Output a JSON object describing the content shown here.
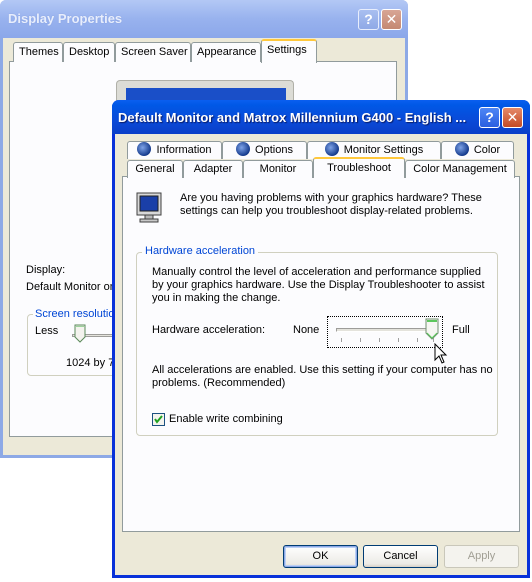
{
  "back_window": {
    "title": "Display Properties",
    "help_glyph": "?",
    "close_glyph": "✕",
    "tabs": [
      "Themes",
      "Desktop",
      "Screen Saver",
      "Appearance",
      "Settings"
    ],
    "active_tab": "Settings",
    "display_label": "Display:",
    "display_value": "Default Monitor on",
    "screen_resolution_label": "Screen resolutio",
    "less_label": "Less",
    "resolution_value": "1024 by 7"
  },
  "front_window": {
    "title": "Default Monitor and Matrox Millennium G400 - English ...",
    "help_glyph": "?",
    "close_glyph": "✕",
    "tabs_row1": [
      {
        "label": "Information",
        "icon": "matrox-icon"
      },
      {
        "label": "Options",
        "icon": "matrox-icon"
      },
      {
        "label": "Monitor Settings",
        "icon": "matrox-icon"
      },
      {
        "label": "Color",
        "icon": "matrox-icon"
      }
    ],
    "tabs_row2": [
      "General",
      "Adapter",
      "Monitor",
      "Troubleshoot",
      "Color Management"
    ],
    "active_tab": "Troubleshoot",
    "intro_text": "Are you having problems with your graphics hardware? These settings can help you troubleshoot display-related problems.",
    "hardware_group": {
      "title": "Hardware acceleration",
      "description": "Manually control the level of acceleration and performance supplied by your graphics hardware. Use the Display Troubleshooter to assist you in making the change.",
      "slider_label": "Hardware acceleration:",
      "slider_min_label": "None",
      "slider_max_label": "Full",
      "slider_level": 1.0,
      "status_text": "All accelerations are enabled. Use this setting if your computer has no problems. (Recommended)",
      "checkbox_label": "Enable write combining",
      "checkbox_checked": true
    },
    "buttons": {
      "ok": "OK",
      "cancel": "Cancel",
      "apply": "Apply"
    }
  },
  "colors": {
    "active_title": "#0a4ad8",
    "inactive_title": "#98b2ee",
    "dialog_face": "#ece9d8",
    "group_label": "#0046d5",
    "tab_highlight": "#ffc83c"
  }
}
